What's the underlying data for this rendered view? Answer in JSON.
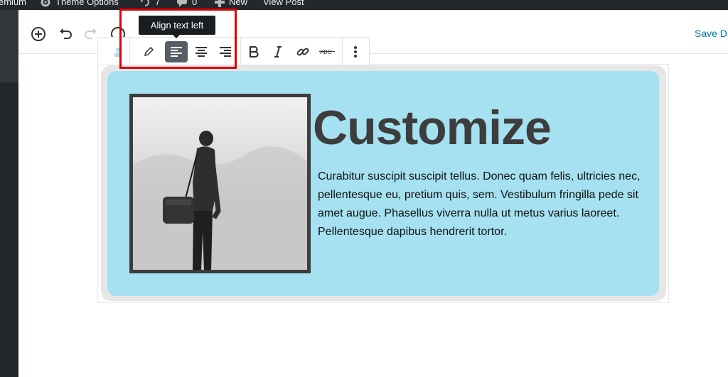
{
  "admin_bar": {
    "premium_label": "emium",
    "theme_options_label": "Theme Options",
    "updates_count": "7",
    "comments_count": "0",
    "new_label": "New",
    "view_post_label": "View Post"
  },
  "editor_header": {
    "save_draft_label": "Save Dr"
  },
  "block_toolbar": {
    "tooltip": "Align text left",
    "buttons": [
      "edit",
      "align-left",
      "align-center",
      "align-right",
      "bold",
      "italic",
      "link",
      "strikethrough",
      "more-options"
    ],
    "active_button": "align-left"
  },
  "content_block": {
    "heading": "Customize",
    "paragraph_lines": [
      "Curabitur suscipit suscipit tellus. Donec quam felis, ultricies nec,",
      "pellentesque eu, pretium quis, sem. Vestibulum fringilla pede sit",
      "amet augue. Phasellus viverra nulla ut metus varius laoreet.",
      "Pellentesque dapibus hendrerit tortor."
    ],
    "image_description": "man-with-shoulder-bag-photo"
  },
  "colors": {
    "admin_bar": "#23282d",
    "block_background": "#a5e1f0",
    "heading_text": "#3d3d3d",
    "link_accent": "#0073aa",
    "annotation_red": "#e00000"
  }
}
